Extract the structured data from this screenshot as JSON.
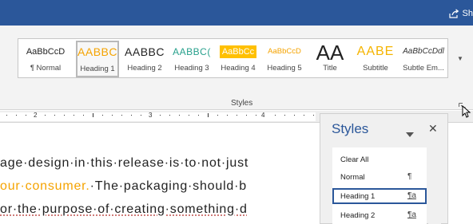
{
  "titlebar": {
    "share_label": "Sh",
    "color": "#2b579a"
  },
  "ribbon": {
    "group_label": "Styles",
    "gallery": [
      {
        "preview": "AaBbCcD",
        "name": "¶ Normal"
      },
      {
        "preview": "AABBC",
        "name": "Heading 1",
        "selected": true
      },
      {
        "preview": "AABBC",
        "name": "Heading 2"
      },
      {
        "preview": "AABBC(",
        "name": "Heading 3"
      },
      {
        "preview": "AaBbCc",
        "name": "Heading 4"
      },
      {
        "preview": "AaBbCcD",
        "name": "Heading 5"
      },
      {
        "preview": "AA",
        "name": "Title"
      },
      {
        "preview": "AABE",
        "name": "Subtitle"
      },
      {
        "preview": "AaBbCcDdl",
        "name": "Subtle Em..."
      }
    ]
  },
  "ruler": {
    "numbers": [
      "2",
      "3",
      "4"
    ]
  },
  "document": {
    "line1": "age·design·in·this·release·is·to·not·just",
    "line2_orange": "our·consumer.",
    "line2_rest": "·The·packaging·should·b",
    "line3": "or·the·purpose·of·creating·something·d"
  },
  "styles_pane": {
    "title": "Styles",
    "items": [
      {
        "label": "Clear All",
        "mark": ""
      },
      {
        "label": "Normal",
        "mark": "¶"
      },
      {
        "label": "Heading 1",
        "mark": "¶a",
        "selected": true
      },
      {
        "label": "Heading 2",
        "mark": "¶a"
      }
    ]
  },
  "colors": {
    "accent": "#2b579a",
    "heading": "#f5a300",
    "heading4_fill": "#ffc000"
  }
}
